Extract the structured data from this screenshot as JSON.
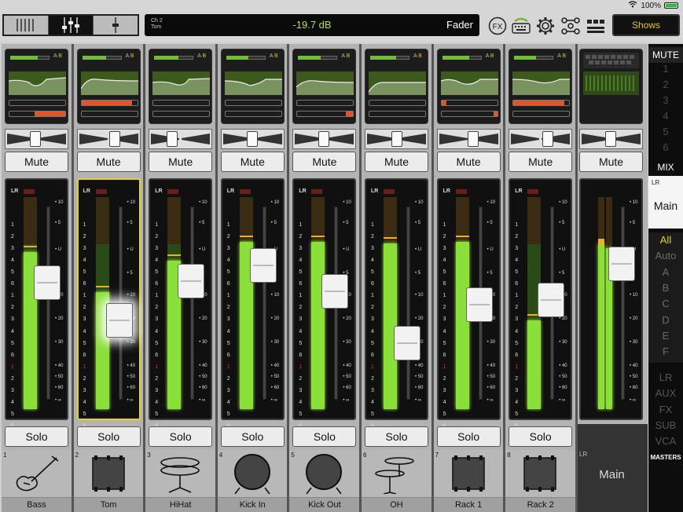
{
  "status": {
    "wifi": "wifi-icon",
    "battery": "100%"
  },
  "toolbar": {
    "selected_channel": {
      "line1": "Ch 2",
      "line2": "Tom"
    },
    "level": "-19.7 dB",
    "mode": "Fader",
    "fx_label": "FX",
    "shows_label": "Shows"
  },
  "meter_labels": {
    "lr": "LR",
    "left_scale": [
      "1",
      "2",
      "3",
      "4",
      "5",
      "6",
      "1",
      "2",
      "3",
      "4",
      "5",
      "6",
      "1",
      "2",
      "3",
      "4",
      "5",
      "6"
    ],
    "db_scale": [
      "10",
      "5",
      "U",
      "5",
      "10",
      "20",
      "30",
      "40",
      "50",
      "60",
      "∞"
    ]
  },
  "channels": [
    {
      "num": "1",
      "name": "Bass",
      "mute": "Mute",
      "solo": "Solo",
      "icon": "bass-guitar-icon",
      "meter": 0.74,
      "fader": 0.66,
      "selected": false
    },
    {
      "num": "2",
      "name": "Tom",
      "mute": "Mute",
      "solo": "Solo",
      "icon": "tom-drum-icon",
      "meter": 0.55,
      "fader": 0.44,
      "selected": true
    },
    {
      "num": "3",
      "name": "HiHat",
      "mute": "Mute",
      "solo": "Solo",
      "icon": "hihat-icon",
      "meter": 0.7,
      "fader": 0.67,
      "selected": false
    },
    {
      "num": "4",
      "name": "Kick In",
      "mute": "Mute",
      "solo": "Solo",
      "icon": "kick-drum-icon",
      "meter": 0.79,
      "fader": 0.76,
      "selected": false
    },
    {
      "num": "5",
      "name": "Kick Out",
      "mute": "Mute",
      "solo": "Solo",
      "icon": "kick-drum-icon",
      "meter": 0.79,
      "fader": 0.61,
      "selected": false
    },
    {
      "num": "6",
      "name": "OH",
      "mute": "Mute",
      "solo": "Solo",
      "icon": "overhead-cymbals-icon",
      "meter": 0.78,
      "fader": 0.31,
      "selected": false
    },
    {
      "num": "7",
      "name": "Rack 1",
      "mute": "Mute",
      "solo": "Solo",
      "icon": "rack-tom-icon",
      "meter": 0.79,
      "fader": 0.53,
      "selected": false
    },
    {
      "num": "8",
      "name": "Rack 2",
      "mute": "Mute",
      "solo": "Solo",
      "icon": "rack-tom-icon",
      "meter": 0.42,
      "fader": 0.56,
      "selected": false
    }
  ],
  "master": {
    "mute": "Mute",
    "lr": "LR",
    "name": "Main",
    "meter": 0.78,
    "fader": 0.77
  },
  "right_panel": {
    "mute_label": "MUTE",
    "mute_groups": [
      "1",
      "2",
      "3",
      "4",
      "5",
      "6"
    ],
    "mix_label": "MIX",
    "mix_lr": "LR",
    "mix_main": "Main",
    "filters": [
      "All",
      "Auto",
      "A",
      "B",
      "C",
      "D",
      "E",
      "F"
    ],
    "masters": [
      "LR",
      "AUX",
      "FX",
      "SUB",
      "VCA"
    ],
    "masters_label": "MASTERS"
  },
  "colors": {
    "accent": "#e6c21a",
    "meter_green": "#8adf38",
    "selected": "#e3d11b"
  }
}
